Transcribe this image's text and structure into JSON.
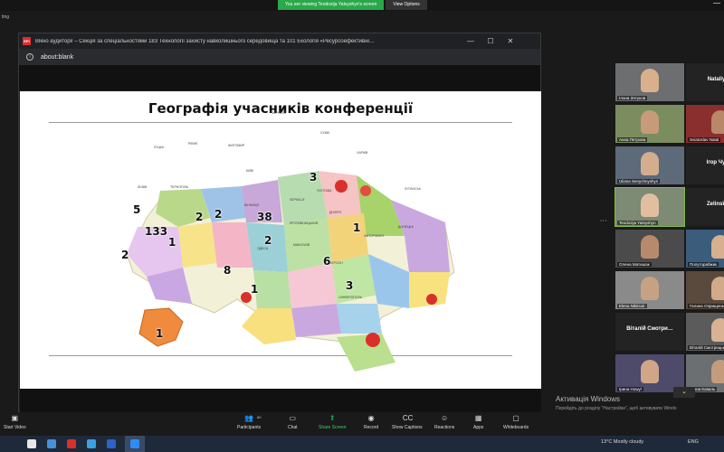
{
  "zoom_banner": {
    "share_text": "You are viewing Teodozija Yatsyshyn's screen",
    "view_options": "View Options",
    "corner_label": "ting"
  },
  "browser": {
    "app_icon": "EPI",
    "title": "Вікно аудиторії – Секція за спеціальностями 183 Технології захисту навколишнього середовища та 101 Екологія «Ресурсоефективні…",
    "minimize": "—",
    "maximize": "☐",
    "close": "✕",
    "url": "about:blank"
  },
  "slide": {
    "title": "Географія учасників конференції",
    "counts": [
      "3",
      "5",
      "2",
      "38",
      "2",
      "1",
      "133",
      "1",
      "2",
      "2",
      "8",
      "6",
      "1",
      "3",
      "1"
    ],
    "regions": [
      "ЧЕРНІГІВ",
      "СУМИ",
      "КИЇВ",
      "ХАРКІВ",
      "ЛУГАНСЬК",
      "ЛУЦЬК",
      "РІВНЕ",
      "ЛЬВІВ",
      "ТЕРНОПІЛЬ",
      "ПОЛТАВА",
      "ВІННИЦЯ",
      "ЧЕРКАСИ",
      "ДНІПРО",
      "ДОНЕЦЬК",
      "ЗАПОРІЖЖЯ",
      "ОДЕСА",
      "МИКОЛАЇВ",
      "ХЕРСОН",
      "СІМФЕРОПОЛЬ",
      "ЖИТОМИР",
      "КРОПИВНИЦЬКИЙ"
    ]
  },
  "gallery": {
    "tiles": [
      {
        "name": "Ілона Зятуков",
        "type": "video"
      },
      {
        "name": "Nataliya Y",
        "type": "text"
      },
      {
        "name": "Анна Петрова",
        "type": "video"
      },
      {
        "name": "Sviatoslav Natal",
        "type": "video"
      },
      {
        "name": "Uliana Senychnyshyn",
        "type": "video"
      },
      {
        "name": "Ігор Чудак",
        "type": "text"
      },
      {
        "name": "Teodozija Yatsyshyn",
        "type": "video"
      },
      {
        "name": "Zelinska H",
        "type": "text"
      },
      {
        "name": "Олена Матишак",
        "type": "video"
      },
      {
        "name": "Полуторабжик",
        "type": "video"
      },
      {
        "name": "Elena Nikitsuk",
        "type": "video"
      },
      {
        "name": "Галина Оприщенко",
        "type": "video"
      },
      {
        "name": "Віталій Смотри…",
        "type": "text"
      },
      {
        "name": "Віталій Смотрицький",
        "type": "video"
      },
      {
        "name": "Ірина Howyl",
        "type": "video"
      },
      {
        "name": "Ганна Коваль",
        "type": "video"
      }
    ]
  },
  "windows_activation": {
    "title": "Активація Windows",
    "subtitle": "Перейдіть до розділу \"Настройки\", щоб активувати Windo"
  },
  "toolbar": {
    "start_video": "Start Video",
    "participants": "Participants",
    "participants_count": "60",
    "chat": "Chat",
    "share_screen": "Share Screen",
    "record": "Record",
    "show_captions": "Show Captions",
    "reactions": "Reactions",
    "apps": "Apps",
    "whiteboards": "Whiteboards"
  },
  "taskbar": {
    "weather": "13°C  Mostly cloudy",
    "lang": "ENG"
  },
  "colors": {
    "share_green": "#2aa84a",
    "active_tile_border": "#7fbf3f"
  }
}
